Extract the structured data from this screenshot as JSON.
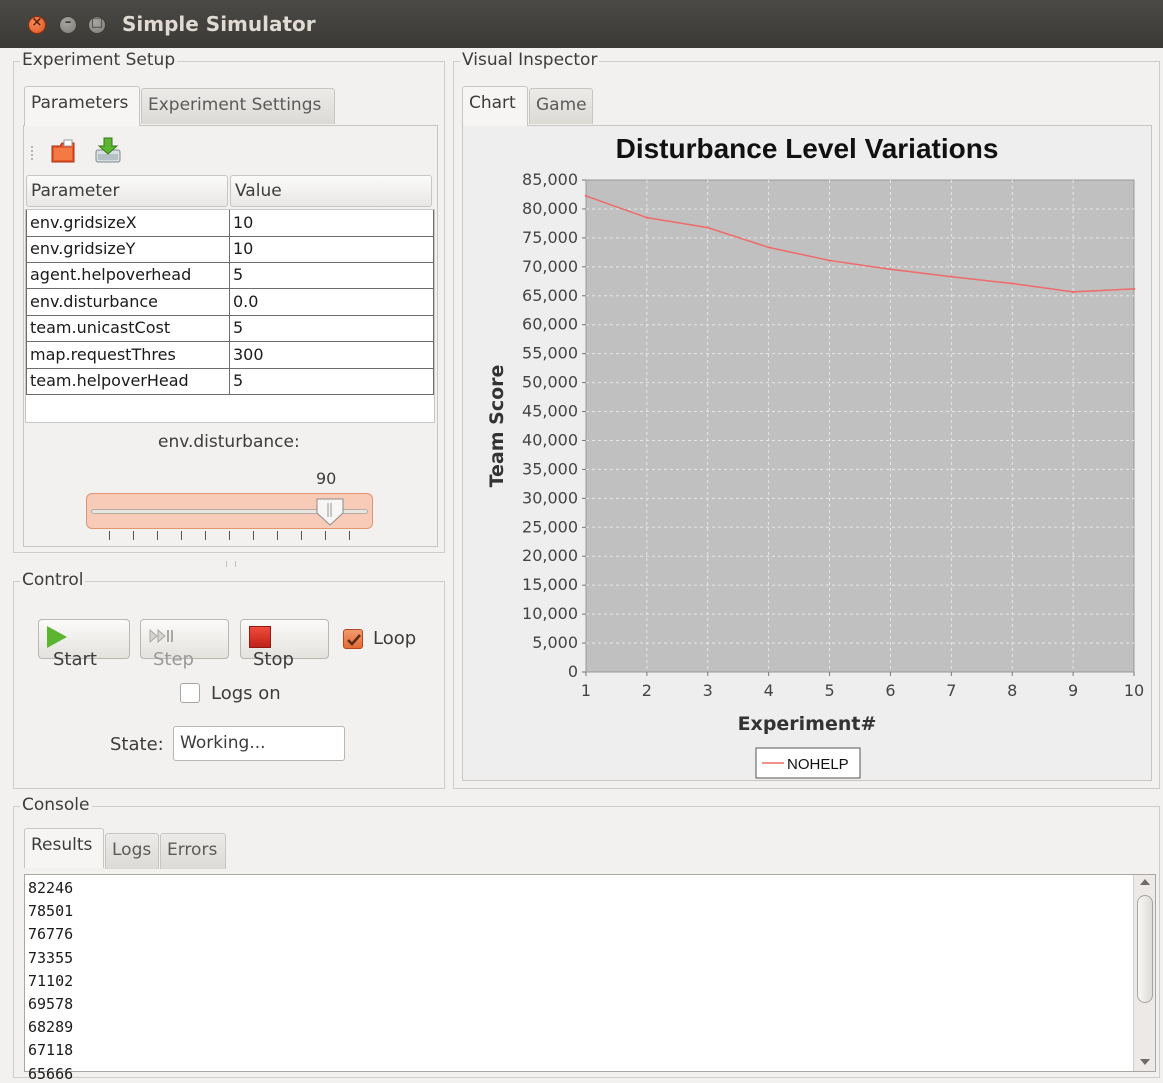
{
  "window": {
    "title": "Simple Simulator",
    "close_glyph": "×",
    "min_glyph": "–",
    "max_glyph": "□"
  },
  "experiment_setup": {
    "title": "Experiment Setup",
    "tabs": [
      {
        "label": "Parameters",
        "active": true
      },
      {
        "label": "Experiment Settings",
        "active": false
      }
    ],
    "toolbar_icons": [
      "open-file-icon",
      "save-download-icon"
    ],
    "table": {
      "headers": [
        "Parameter",
        "Value"
      ],
      "rows": [
        [
          "env.gridsizeX",
          "10"
        ],
        [
          "env.gridsizeY",
          "10"
        ],
        [
          "agent.helpoverhead",
          "5"
        ],
        [
          "env.disturbance",
          "0.0"
        ],
        [
          "team.unicastCost",
          "5"
        ],
        [
          "map.requestThres",
          "300"
        ],
        [
          "team.helpoverHead",
          "5"
        ]
      ]
    },
    "slider": {
      "label": "env.disturbance:",
      "value_text": "90",
      "value": 90,
      "min": 0,
      "max": 100
    }
  },
  "control": {
    "title": "Control",
    "start_label": "Start",
    "step_label": "Step",
    "stop_label": "Stop",
    "loop_label": "Loop",
    "loop_checked": true,
    "logs_label": "Logs on",
    "logs_checked": false,
    "state_label": "State:",
    "state_value": "Working..."
  },
  "visual_inspector": {
    "title": "Visual Inspector",
    "tabs": [
      {
        "label": "Chart",
        "active": true
      },
      {
        "label": "Game",
        "active": false
      }
    ]
  },
  "chart_data": {
    "type": "line",
    "title": "Disturbance Level Variations",
    "xlabel": "Experiment#",
    "ylabel": "Team Score",
    "x": [
      1,
      2,
      3,
      4,
      5,
      6,
      7,
      8,
      9,
      10
    ],
    "series": [
      {
        "name": "NOHELP",
        "color": "#f06a6a",
        "values": [
          82246,
          78501,
          76776,
          73355,
          71102,
          69578,
          68289,
          67118,
          65666,
          66200
        ]
      }
    ],
    "xlim": [
      1,
      10
    ],
    "ylim": [
      0,
      85000
    ],
    "yticks": [
      "0",
      "5,000",
      "10,000",
      "15,000",
      "20,000",
      "25,000",
      "30,000",
      "35,000",
      "40,000",
      "45,000",
      "50,000",
      "55,000",
      "60,000",
      "65,000",
      "70,000",
      "75,000",
      "80,000",
      "85,000"
    ],
    "ytick_values": [
      0,
      5000,
      10000,
      15000,
      20000,
      25000,
      30000,
      35000,
      40000,
      45000,
      50000,
      55000,
      60000,
      65000,
      70000,
      75000,
      80000,
      85000
    ],
    "xticks": [
      "1",
      "2",
      "3",
      "4",
      "5",
      "6",
      "7",
      "8",
      "9",
      "10"
    ],
    "grid": true,
    "plot_background": "#c0c0c0",
    "legend": "bottom"
  },
  "console": {
    "title": "Console",
    "tabs": [
      {
        "label": "Results",
        "active": true
      },
      {
        "label": "Logs",
        "active": false
      },
      {
        "label": "Errors",
        "active": false
      }
    ],
    "lines": [
      "82246",
      "78501",
      "76776",
      "73355",
      "71102",
      "69578",
      "68289",
      "67118",
      "65666"
    ]
  }
}
